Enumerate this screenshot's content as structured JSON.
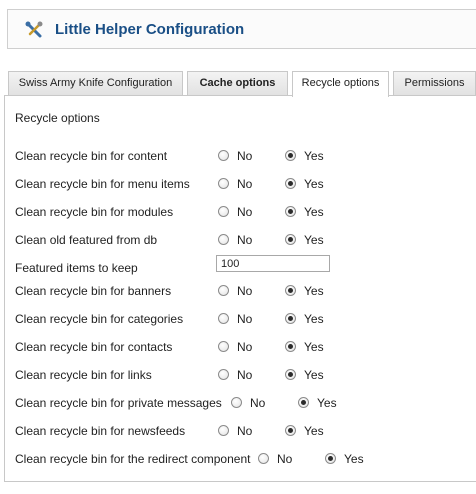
{
  "header": {
    "title": "Little Helper Configuration",
    "icon": "wrench-screwdriver-icon"
  },
  "tabs": [
    {
      "label": "Swiss Army Knife Configuration",
      "active": false,
      "bold": false
    },
    {
      "label": "Cache options",
      "active": false,
      "bold": true
    },
    {
      "label": "Recycle options",
      "active": true,
      "bold": false
    },
    {
      "label": "Permissions",
      "active": false,
      "bold": false
    }
  ],
  "section": {
    "title": "Recycle options"
  },
  "options": {
    "no": "No",
    "yes": "Yes"
  },
  "rows": [
    {
      "label": "Clean recycle bin for content",
      "selected": "yes"
    },
    {
      "label": "Clean recycle bin for menu items",
      "selected": "yes"
    },
    {
      "label": "Clean recycle bin for modules",
      "selected": "yes"
    },
    {
      "label": "Clean old featured from db",
      "selected": "yes"
    },
    {
      "label": "Featured items to keep",
      "value": "100"
    },
    {
      "label": "Clean recycle bin for banners",
      "selected": "yes"
    },
    {
      "label": "Clean recycle bin for categories",
      "selected": "yes"
    },
    {
      "label": "Clean recycle bin for contacts",
      "selected": "yes"
    },
    {
      "label": "Clean recycle bin for links",
      "selected": "yes"
    },
    {
      "label": "Clean recycle bin for private messages",
      "selected": "yes"
    },
    {
      "label": "Clean recycle bin for newsfeeds",
      "selected": "yes"
    },
    {
      "label": "Clean recycle bin for the redirect component",
      "selected": "yes"
    }
  ]
}
